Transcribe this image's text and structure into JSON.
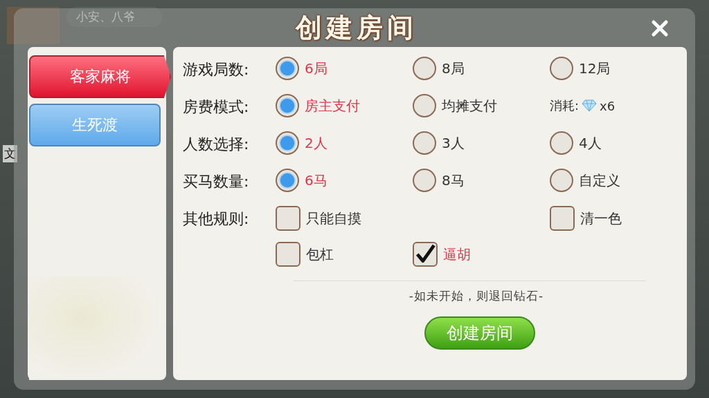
{
  "background": {
    "player_name": "小安、八爷",
    "side_text": "文"
  },
  "dialog": {
    "title": "创建房间"
  },
  "games": [
    {
      "label": "客家麻将",
      "selected": true
    },
    {
      "label": "生死渡",
      "selected": false
    }
  ],
  "rules": [
    {
      "label": "游戏局数:",
      "kind": "radio",
      "lines": [
        [
          {
            "label": "6局",
            "selected": true
          },
          {
            "label": "8局",
            "selected": false
          },
          {
            "label": "12局",
            "selected": false
          }
        ]
      ]
    },
    {
      "label": "房费模式:",
      "kind": "radio",
      "lines": [
        [
          {
            "label": "房主支付",
            "selected": true
          },
          {
            "label": "均摊支付",
            "selected": false
          }
        ]
      ],
      "cost": {
        "label": "消耗:",
        "amount": "x6"
      }
    },
    {
      "label": "人数选择:",
      "kind": "radio",
      "lines": [
        [
          {
            "label": "2人",
            "selected": true
          },
          {
            "label": "3人",
            "selected": false
          },
          {
            "label": "4人",
            "selected": false
          }
        ]
      ]
    },
    {
      "label": "买马数量:",
      "kind": "radio",
      "lines": [
        [
          {
            "label": "6马",
            "selected": true
          },
          {
            "label": "8马",
            "selected": false
          },
          {
            "label": "自定义",
            "selected": false
          }
        ]
      ]
    },
    {
      "label": "其他规则:",
      "kind": "checkbox",
      "lines": [
        [
          {
            "label": "只能自摸",
            "checked": false
          },
          {
            "label": "清一色",
            "checked": false
          }
        ],
        [
          {
            "label": "包杠",
            "checked": false
          },
          {
            "label": "逼胡",
            "checked": true
          }
        ]
      ]
    }
  ],
  "note": "-如未开始，则退回钻石-",
  "create_button": "创建房间"
}
